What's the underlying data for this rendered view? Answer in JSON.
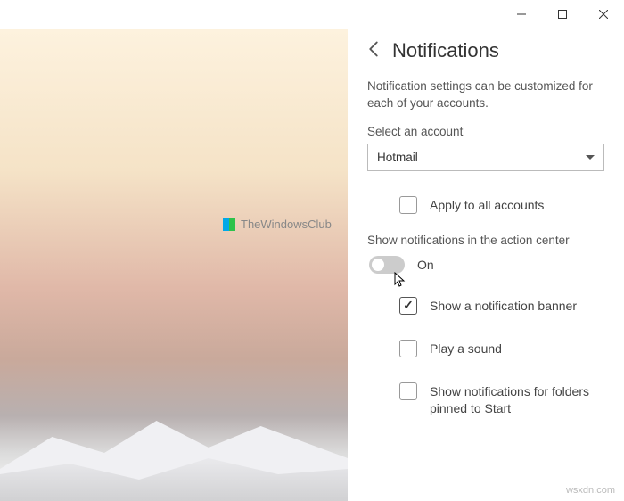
{
  "window": {
    "minimize": "−",
    "maximize": "▢",
    "close": "✕"
  },
  "panel": {
    "title": "Notifications",
    "description": "Notification settings can be customized for each of your accounts.",
    "selectLabel": "Select an account",
    "selectedAccount": "Hotmail",
    "applyAll": "Apply to all accounts",
    "actionCenterLabel": "Show notifications in the action center",
    "toggleState": "On",
    "opts": {
      "banner": "Show a notification banner",
      "sound": "Play a sound",
      "pinned": "Show notifications for folders pinned to Start"
    }
  },
  "watermark": "TheWindowsClub",
  "domainMark": "wsxdn.com"
}
